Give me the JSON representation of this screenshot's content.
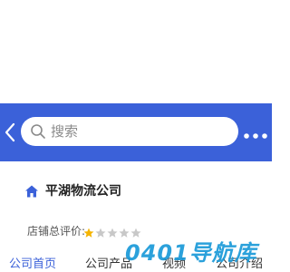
{
  "header": {
    "background_color": "#3b61d9",
    "back_icon": "chevron-left-icon",
    "search": {
      "placeholder": "搜索",
      "icon": "search-icon"
    },
    "more_icon": "more-dots-icon"
  },
  "company": {
    "icon": "home-icon",
    "name": "平湖物流公司"
  },
  "rating": {
    "label": "店铺总评价:",
    "score": 1,
    "max": 5,
    "filled_color": "#f5b400",
    "empty_color": "#c8c8c8"
  },
  "tabs": [
    {
      "label": "公司首页",
      "active": true
    },
    {
      "label": "公司产品",
      "active": false
    },
    {
      "label": "视频",
      "active": false
    },
    {
      "label": "公司介绍",
      "active": false
    }
  ],
  "watermark": {
    "text": "0401导航库",
    "color": "#1a9ad8"
  }
}
